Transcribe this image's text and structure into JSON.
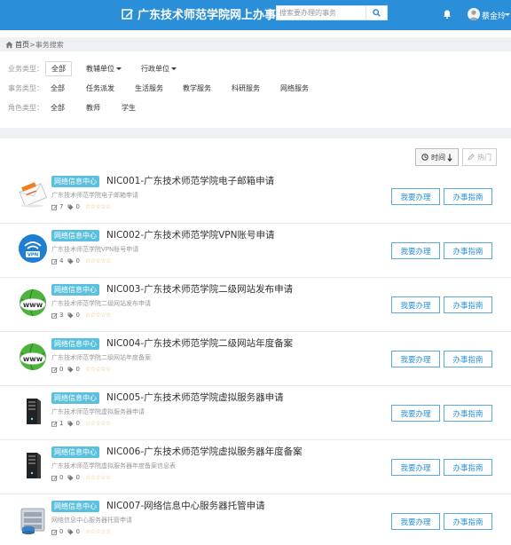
{
  "header": {
    "title": "广东技术师范学院网上办事大厅",
    "search_placeholder": "搜索要办理的事务",
    "username": "蔡金玲"
  },
  "breadcrumb": {
    "home": "首页",
    "separator": ">",
    "current": "事务搜索"
  },
  "filters": {
    "business_type": {
      "label": "业务类型：",
      "options": [
        "全部",
        "教辅单位",
        "行政单位"
      ],
      "selected": "全部"
    },
    "affair_type": {
      "label": "事务类型：",
      "options": [
        "全部",
        "任务派发",
        "生活服务",
        "教学服务",
        "科研服务",
        "网络服务"
      ]
    },
    "role_type": {
      "label": "角色类型：",
      "options": [
        "全部",
        "教师",
        "学生"
      ]
    }
  },
  "sort": {
    "time_label": "时间",
    "hot_label": "热门"
  },
  "items": [
    {
      "dept": "网络信息中心",
      "title": "NIC001-广东技术师范学院电子邮箱申请",
      "desc": "广东技术师范学院电子邮箱申请",
      "edits": "7",
      "tags": "0",
      "rating": 0,
      "icon": "email-icon"
    },
    {
      "dept": "网络信息中心",
      "title": "NIC002-广东技术师范学院VPN账号申请",
      "desc": "广东技术师范学院VPN账号申请",
      "edits": "4",
      "tags": "0",
      "rating": 0,
      "icon": "vpn-icon"
    },
    {
      "dept": "网络信息中心",
      "title": "NIC003-广东技术师范学院二级网站发布申请",
      "desc": "广东技术师范学院二级网站发布申请",
      "edits": "3",
      "tags": "0",
      "rating": 0,
      "icon": "www-globe-icon"
    },
    {
      "dept": "网络信息中心",
      "title": "NIC004-广东技术师范学院二级网站年度备案",
      "desc": "广东技术师范学院二级网站年度备案",
      "edits": "0",
      "tags": "0",
      "rating": 0,
      "icon": "www-globe-icon"
    },
    {
      "dept": "网络信息中心",
      "title": "NIC005-广东技术师范学院虚拟服务器申请",
      "desc": "广东技术师范学院虚拟服务器申请",
      "edits": "1",
      "tags": "0",
      "rating": 0,
      "icon": "server-tower-icon"
    },
    {
      "dept": "网络信息中心",
      "title": "NIC006-广东技术师范学院虚拟服务器年度备案",
      "desc": "广东技术师范学院虚拟服务器年度备案信息表",
      "edits": "0",
      "tags": "0",
      "rating": 0,
      "icon": "server-tower-icon"
    },
    {
      "dept": "网络信息中心",
      "title": "NIC007-网络信息中心服务器托管申请",
      "desc": "网络信息中心服务器托管申请",
      "edits": "0",
      "tags": "0",
      "rating": 0,
      "icon": "database-server-icon"
    }
  ],
  "buttons": {
    "handle_label": "我要办理",
    "guide_label": "办事指南"
  },
  "colors": {
    "header_blue": "#2a8fd8",
    "dept_badge": "#5bc0de",
    "button_blue": "#2a8fd8",
    "star": "#f0ad4e"
  }
}
